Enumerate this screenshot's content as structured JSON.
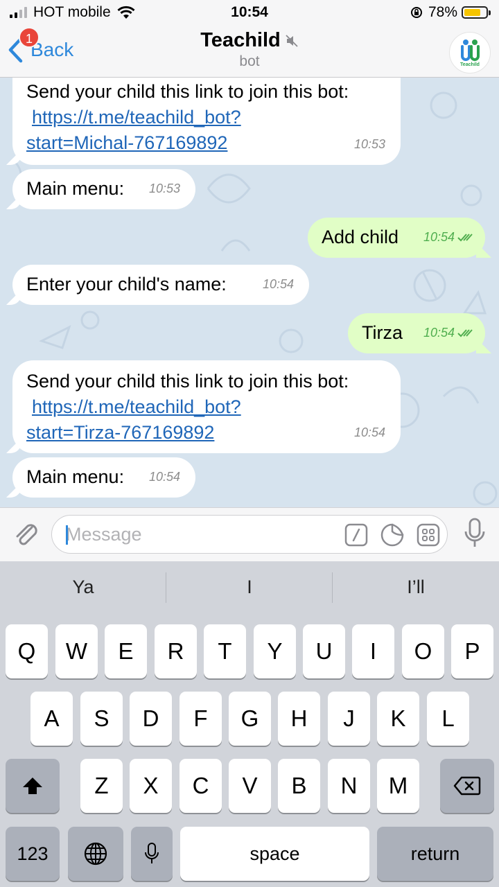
{
  "status_bar": {
    "carrier": "HOT mobile",
    "time": "10:54",
    "battery": "78%",
    "battery_level": 0.78,
    "battery_color": "#f7c500"
  },
  "nav": {
    "back_label": "Back",
    "badge_count": "1",
    "title": "Teachild",
    "subtitle": "bot",
    "avatar_text": "Teachild"
  },
  "messages": [
    {
      "dir": "in",
      "text": "Send your child this link to join this bot:",
      "link": "https://t.me/teachild_bot?start=Michal-767169892",
      "link_line1": "https://t.me/teachild_bot?",
      "link_line2": "start=Michal-767169892",
      "time": "10:53"
    },
    {
      "dir": "in",
      "text": "Main menu:",
      "time": "10:53"
    },
    {
      "dir": "out",
      "text": "Add child",
      "time": "10:54",
      "read": true
    },
    {
      "dir": "in",
      "text": "Enter your child's name:",
      "time": "10:54"
    },
    {
      "dir": "out",
      "text": "Tirza",
      "time": "10:54",
      "read": true
    },
    {
      "dir": "in",
      "text": "Send your child this link to join this bot:",
      "link": "https://t.me/teachild_bot?start=Tirza-767169892",
      "link_line1": "https://t.me/teachild_bot?",
      "link_line2": "start=Tirza-767169892",
      "time": "10:54"
    },
    {
      "dir": "in",
      "text": "Main menu:",
      "time": "10:54"
    }
  ],
  "input": {
    "placeholder": "Message"
  },
  "keyboard": {
    "suggestions": [
      "Ya",
      "I",
      "I’ll"
    ],
    "row1": [
      "Q",
      "W",
      "E",
      "R",
      "T",
      "Y",
      "U",
      "I",
      "O",
      "P"
    ],
    "row2": [
      "A",
      "S",
      "D",
      "F",
      "G",
      "H",
      "J",
      "K",
      "L"
    ],
    "row3": [
      "Z",
      "X",
      "C",
      "V",
      "B",
      "N",
      "M"
    ],
    "numbers_label": "123",
    "space_label": "space",
    "return_label": "return"
  },
  "colors": {
    "chat_bg": "#d6e3ee",
    "outgoing_bubble": "#e1fec6",
    "link": "#1f66b8",
    "accent": "#2e88db"
  }
}
